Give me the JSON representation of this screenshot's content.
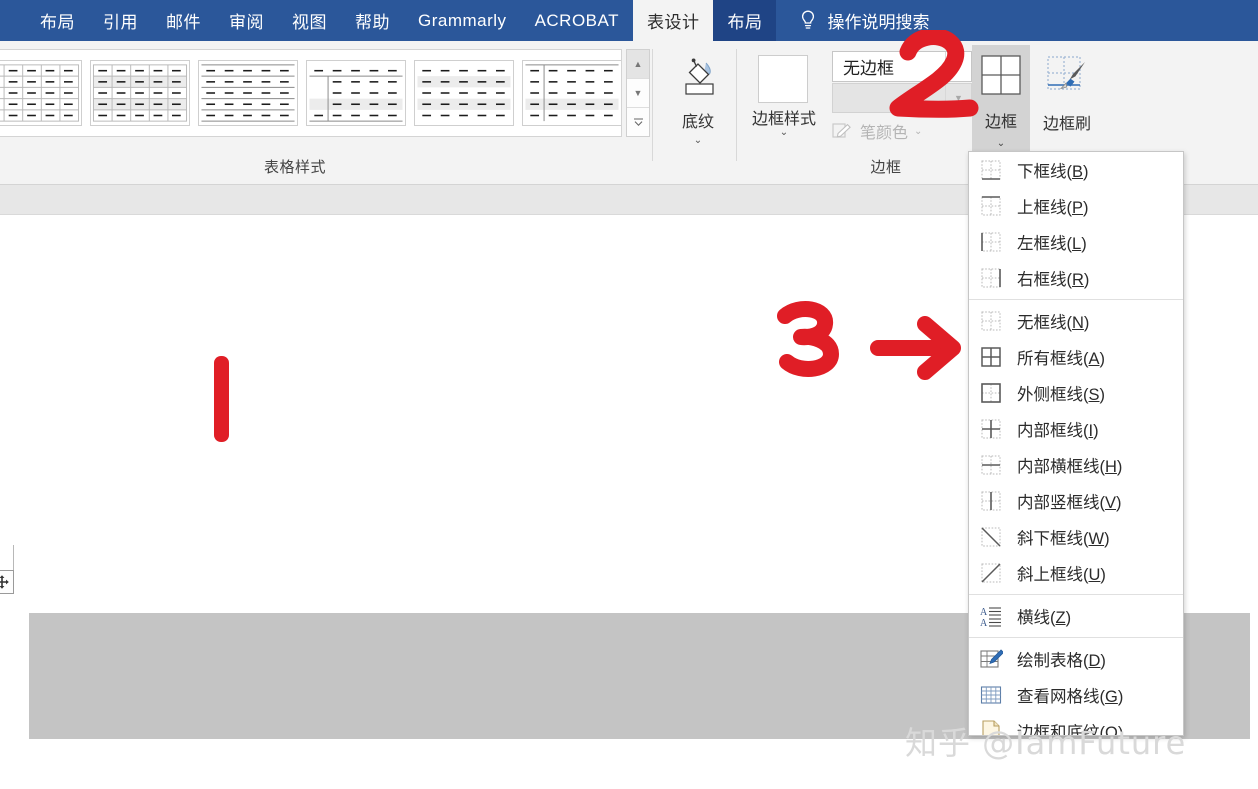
{
  "tabs": [
    {
      "label": "布局",
      "state": "normal"
    },
    {
      "label": "引用",
      "state": "normal"
    },
    {
      "label": "邮件",
      "state": "normal"
    },
    {
      "label": "审阅",
      "state": "normal"
    },
    {
      "label": "视图",
      "state": "normal"
    },
    {
      "label": "帮助",
      "state": "normal"
    },
    {
      "label": "Grammarly",
      "state": "normal"
    },
    {
      "label": "ACROBAT",
      "state": "normal"
    },
    {
      "label": "表设计",
      "state": "active"
    },
    {
      "label": "布局",
      "state": "contextual"
    }
  ],
  "tellme": {
    "label": "操作说明搜索",
    "icon": "lightbulb-icon"
  },
  "ribbon": {
    "groups": {
      "table_styles": {
        "label": "表格样式"
      },
      "shading": {
        "label": "底纹",
        "icon": "paint-bucket-icon",
        "chevron": "⌄"
      },
      "borders": {
        "label": "边框",
        "border_styles_label": "边框样式",
        "border_styles_chevron": "⌄",
        "pen_width_value": "无边框",
        "pen_width_arrow": "▼",
        "pen_style_arrow": "▼",
        "pen_color_label": "笔颜色",
        "pen_color_chevron": "⌄",
        "borders_button_label": "边框",
        "borders_button_chevron": "⌄",
        "border_painter_label": "边框刷"
      }
    },
    "gallery_scroll": {
      "up": "▲",
      "down": "▼",
      "more": "▼"
    }
  },
  "borders_menu": {
    "items": [
      {
        "label": "下框线(B)",
        "text": "下框线(",
        "key": "B",
        "tail": ")",
        "icon": "border-bottom-icon"
      },
      {
        "label": "上框线(P)",
        "text": "上框线(",
        "key": "P",
        "tail": ")",
        "icon": "border-top-icon"
      },
      {
        "label": "左框线(L)",
        "text": "左框线(",
        "key": "L",
        "tail": ")",
        "icon": "border-left-icon"
      },
      {
        "label": "右框线(R)",
        "text": "右框线(",
        "key": "R",
        "tail": ")",
        "icon": "border-right-icon"
      },
      {
        "separator": true
      },
      {
        "label": "无框线(N)",
        "text": "无框线(",
        "key": "N",
        "tail": ")",
        "icon": "border-none-icon"
      },
      {
        "label": "所有框线(A)",
        "text": "所有框线(",
        "key": "A",
        "tail": ")",
        "icon": "border-all-icon"
      },
      {
        "label": "外侧框线(S)",
        "text": "外侧框线(",
        "key": "S",
        "tail": ")",
        "icon": "border-outside-icon"
      },
      {
        "label": "内部框线(I)",
        "text": "内部框线(",
        "key": "I",
        "tail": ")",
        "icon": "border-inside-icon"
      },
      {
        "label": "内部横框线(H)",
        "text": "内部横框线(",
        "key": "H",
        "tail": ")",
        "icon": "border-inside-horizontal-icon"
      },
      {
        "label": "内部竖框线(V)",
        "text": "内部竖框线(",
        "key": "V",
        "tail": ")",
        "icon": "border-inside-vertical-icon"
      },
      {
        "label": "斜下框线(W)",
        "text": "斜下框线(",
        "key": "W",
        "tail": ")",
        "icon": "border-diagonal-down-icon"
      },
      {
        "label": "斜上框线(U)",
        "text": "斜上框线(",
        "key": "U",
        "tail": ")",
        "icon": "border-diagonal-up-icon"
      },
      {
        "separator": true
      },
      {
        "label": "横线(Z)",
        "text": "横线(",
        "key": "Z",
        "tail": ")",
        "icon": "horizontal-line-icon"
      },
      {
        "separator": true
      },
      {
        "label": "绘制表格(D)",
        "text": "绘制表格(",
        "key": "D",
        "tail": ")",
        "icon": "draw-table-icon"
      },
      {
        "label": "查看网格线(G)",
        "text": "查看网格线(",
        "key": "G",
        "tail": ")",
        "icon": "view-gridlines-icon"
      },
      {
        "label": "边框和底纹(O)...",
        "text": "边框和底纹(",
        "key": "O",
        "tail": ")...",
        "icon": "borders-and-shading-icon"
      }
    ]
  },
  "annotations": {
    "step1": "1",
    "step2": "2",
    "step3": "3",
    "color": "#e01e26"
  },
  "watermark": {
    "text": "知乎 @IamFuture"
  },
  "colors": {
    "ribbon_blue": "#2b579a",
    "contextual_blue": "#1f4485",
    "ribbon_bg": "#f3f3f3",
    "table_fill": "#c4c4c4",
    "annotation_red": "#e01e26"
  }
}
